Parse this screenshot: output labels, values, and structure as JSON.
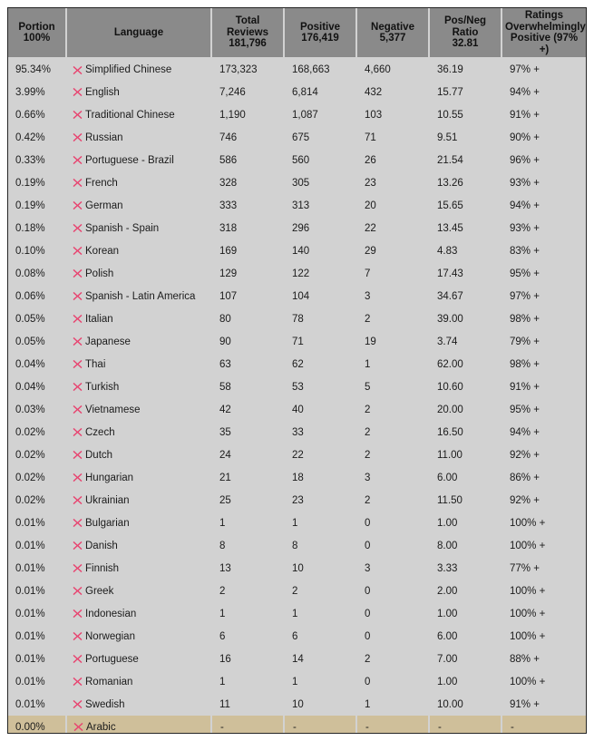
{
  "table": {
    "columns": [
      {
        "key": "portion",
        "title": "Portion",
        "sub": "100%"
      },
      {
        "key": "language",
        "title": "Language",
        "sub": ""
      },
      {
        "key": "total",
        "title": "Total Reviews",
        "sub": "181,796"
      },
      {
        "key": "positive",
        "title": "Positive",
        "sub": "176,419"
      },
      {
        "key": "negative",
        "title": "Negative",
        "sub": "5,377"
      },
      {
        "key": "ratio",
        "title": "Pos/Neg Ratio",
        "sub": "32.81"
      },
      {
        "key": "ratings",
        "title": "Ratings Overwhelmingly",
        "sub": "Positive (97% +)"
      }
    ],
    "header": {
      "portion_title": "Portion",
      "portion_sub": "100%",
      "language_title": "Language",
      "total_title_l1": "Total",
      "total_title_l2": "Reviews",
      "total_sub": "181,796",
      "positive_title": "Positive",
      "positive_sub": "176,419",
      "negative_title": "Negative",
      "negative_sub": "5,377",
      "ratio_title_l1": "Pos/Neg",
      "ratio_title_l2": "Ratio",
      "ratio_sub": "32.81",
      "ratings_title_l1": "Ratings",
      "ratings_title_l2": "Overwhelmingly",
      "ratings_title_l3": "Positive (97% +)"
    },
    "icon": {
      "name": "red-x-icon",
      "color": "#e8436f"
    },
    "colors": {
      "header_bg": "#8a8a8a",
      "body_bg": "#d2d2d2",
      "highlight_bg": "#cfbf9a",
      "border": "#262626",
      "text": "#1b1b1b",
      "icon_red": "#e8436f",
      "page_bg": "#ffffff"
    },
    "rows": [
      {
        "portion": "95.34%",
        "language": "Simplified Chinese",
        "total": "173,323",
        "positive": "168,663",
        "negative": "4,660",
        "ratio": "36.19",
        "ratings": "97% +",
        "highlight": false
      },
      {
        "portion": "3.99%",
        "language": "English",
        "total": "7,246",
        "positive": "6,814",
        "negative": "432",
        "ratio": "15.77",
        "ratings": "94% +",
        "highlight": false
      },
      {
        "portion": "0.66%",
        "language": "Traditional Chinese",
        "total": "1,190",
        "positive": "1,087",
        "negative": "103",
        "ratio": "10.55",
        "ratings": "91% +",
        "highlight": false
      },
      {
        "portion": "0.42%",
        "language": "Russian",
        "total": "746",
        "positive": "675",
        "negative": "71",
        "ratio": "9.51",
        "ratings": "90% +",
        "highlight": false
      },
      {
        "portion": "0.33%",
        "language": "Portuguese - Brazil",
        "total": "586",
        "positive": "560",
        "negative": "26",
        "ratio": "21.54",
        "ratings": "96% +",
        "highlight": false
      },
      {
        "portion": "0.19%",
        "language": "French",
        "total": "328",
        "positive": "305",
        "negative": "23",
        "ratio": "13.26",
        "ratings": "93% +",
        "highlight": false
      },
      {
        "portion": "0.19%",
        "language": "German",
        "total": "333",
        "positive": "313",
        "negative": "20",
        "ratio": "15.65",
        "ratings": "94% +",
        "highlight": false
      },
      {
        "portion": "0.18%",
        "language": "Spanish - Spain",
        "total": "318",
        "positive": "296",
        "negative": "22",
        "ratio": "13.45",
        "ratings": "93% +",
        "highlight": false
      },
      {
        "portion": "0.10%",
        "language": "Korean",
        "total": "169",
        "positive": "140",
        "negative": "29",
        "ratio": "4.83",
        "ratings": "83% +",
        "highlight": false
      },
      {
        "portion": "0.08%",
        "language": "Polish",
        "total": "129",
        "positive": "122",
        "negative": "7",
        "ratio": "17.43",
        "ratings": "95% +",
        "highlight": false
      },
      {
        "portion": "0.06%",
        "language": "Spanish - Latin America",
        "total": "107",
        "positive": "104",
        "negative": "3",
        "ratio": "34.67",
        "ratings": "97% +",
        "highlight": false
      },
      {
        "portion": "0.05%",
        "language": "Italian",
        "total": "80",
        "positive": "78",
        "negative": "2",
        "ratio": "39.00",
        "ratings": "98% +",
        "highlight": false
      },
      {
        "portion": "0.05%",
        "language": "Japanese",
        "total": "90",
        "positive": "71",
        "negative": "19",
        "ratio": "3.74",
        "ratings": "79% +",
        "highlight": false
      },
      {
        "portion": "0.04%",
        "language": "Thai",
        "total": "63",
        "positive": "62",
        "negative": "1",
        "ratio": "62.00",
        "ratings": "98% +",
        "highlight": false
      },
      {
        "portion": "0.04%",
        "language": "Turkish",
        "total": "58",
        "positive": "53",
        "negative": "5",
        "ratio": "10.60",
        "ratings": "91% +",
        "highlight": false
      },
      {
        "portion": "0.03%",
        "language": "Vietnamese",
        "total": "42",
        "positive": "40",
        "negative": "2",
        "ratio": "20.00",
        "ratings": "95% +",
        "highlight": false
      },
      {
        "portion": "0.02%",
        "language": "Czech",
        "total": "35",
        "positive": "33",
        "negative": "2",
        "ratio": "16.50",
        "ratings": "94% +",
        "highlight": false
      },
      {
        "portion": "0.02%",
        "language": "Dutch",
        "total": "24",
        "positive": "22",
        "negative": "2",
        "ratio": "11.00",
        "ratings": "92% +",
        "highlight": false
      },
      {
        "portion": "0.02%",
        "language": "Hungarian",
        "total": "21",
        "positive": "18",
        "negative": "3",
        "ratio": "6.00",
        "ratings": "86% +",
        "highlight": false
      },
      {
        "portion": "0.02%",
        "language": "Ukrainian",
        "total": "25",
        "positive": "23",
        "negative": "2",
        "ratio": "11.50",
        "ratings": "92% +",
        "highlight": false
      },
      {
        "portion": "0.01%",
        "language": "Bulgarian",
        "total": "1",
        "positive": "1",
        "negative": "0",
        "ratio": "1.00",
        "ratings": "100% +",
        "highlight": false
      },
      {
        "portion": "0.01%",
        "language": "Danish",
        "total": "8",
        "positive": "8",
        "negative": "0",
        "ratio": "8.00",
        "ratings": "100% +",
        "highlight": false
      },
      {
        "portion": "0.01%",
        "language": "Finnish",
        "total": "13",
        "positive": "10",
        "negative": "3",
        "ratio": "3.33",
        "ratings": "77% +",
        "highlight": false
      },
      {
        "portion": "0.01%",
        "language": "Greek",
        "total": "2",
        "positive": "2",
        "negative": "0",
        "ratio": "2.00",
        "ratings": "100% +",
        "highlight": false
      },
      {
        "portion": "0.01%",
        "language": "Indonesian",
        "total": "1",
        "positive": "1",
        "negative": "0",
        "ratio": "1.00",
        "ratings": "100% +",
        "highlight": false
      },
      {
        "portion": "0.01%",
        "language": "Norwegian",
        "total": "6",
        "positive": "6",
        "negative": "0",
        "ratio": "6.00",
        "ratings": "100% +",
        "highlight": false
      },
      {
        "portion": "0.01%",
        "language": "Portuguese",
        "total": "16",
        "positive": "14",
        "negative": "2",
        "ratio": "7.00",
        "ratings": "88% +",
        "highlight": false
      },
      {
        "portion": "0.01%",
        "language": "Romanian",
        "total": "1",
        "positive": "1",
        "negative": "0",
        "ratio": "1.00",
        "ratings": "100% +",
        "highlight": false
      },
      {
        "portion": "0.01%",
        "language": "Swedish",
        "total": "11",
        "positive": "10",
        "negative": "1",
        "ratio": "10.00",
        "ratings": "91% +",
        "highlight": false
      },
      {
        "portion": "0.00%",
        "language": "Arabic",
        "total": "-",
        "positive": "-",
        "negative": "-",
        "ratio": "-",
        "ratings": "-",
        "highlight": true
      }
    ]
  }
}
